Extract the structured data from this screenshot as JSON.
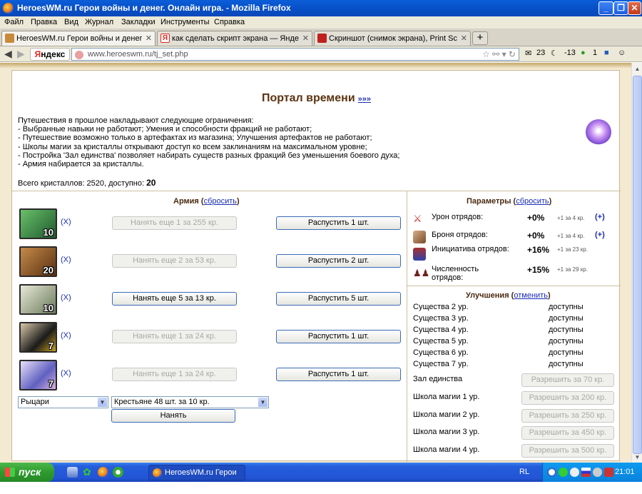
{
  "window": {
    "title": "HeroesWM.ru Герои войны и денег. Онлайн игра. - Mozilla Firefox"
  },
  "menu": [
    "Файл",
    "Правка",
    "Вид",
    "Журнал",
    "Закладки",
    "Инструменты",
    "Справка"
  ],
  "tabs": [
    {
      "label": "HeroesWM.ru Герои войны и денег. Он...",
      "favicon_color": "#c88a3a"
    },
    {
      "label": "как сделать скрипт экрана — Яндекс:...",
      "favicon_color": "#e52620"
    },
    {
      "label": "Скриншот (снимок экрана), Print Screen",
      "favicon_color": "#c02020"
    }
  ],
  "nav": {
    "yandex": "Яндекс",
    "url": "www.heroeswm.ru/tj_set.php",
    "mail_count": "23",
    "temp": "-13",
    "counter": "1"
  },
  "page": {
    "title": "Портал времени",
    "title_link": "»»»",
    "desc": [
      "Путешествия в прошлое накладывают следующие ограничения:",
      "- Выбранные навыки не работают; Умения и способности фракций не работают;",
      "- Путешествие возможно только в артефактах из магазина; Улучшения артефактов не работают;",
      "- Школы магии за кристаллы открывают доступ ко всем заклинаниям на максимальном уровне;",
      "- Постройка 'Зал единства' позволяет набирать существ разных фракций без уменьшения боевого духа;",
      "- Армия набирается за кристаллы."
    ],
    "crystals_label": "Всего кристаллов: 2520, доступно:",
    "crystals_available": "20"
  },
  "army": {
    "title": "Армия",
    "reset": "сбросить",
    "units": [
      {
        "count": "10",
        "remove": "(X)",
        "hire": "Нанять еще 1 за 255 кр.",
        "hire_enabled": false,
        "dismiss": "Распустить 1 шт.",
        "color": "#3a8a3a"
      },
      {
        "count": "20",
        "remove": "(X)",
        "hire": "Нанять еще 2 за 53 кр.",
        "hire_enabled": false,
        "dismiss": "Распустить 2 шт.",
        "color": "#8a5a2a"
      },
      {
        "count": "10",
        "remove": "(X)",
        "hire": "Нанять еще 5 за 13 кр.",
        "hire_enabled": true,
        "dismiss": "Распустить 5 шт.",
        "color": "#7a8a7a"
      },
      {
        "count": "7",
        "remove": "(X)",
        "hire": "Нанять еще 1 за 24 кр.",
        "hire_enabled": false,
        "dismiss": "Распустить 1 шт.",
        "color": "#2a2a2a"
      },
      {
        "count": "7",
        "remove": "(X)",
        "hire": "Нанять еще 1 за 24 кр.",
        "hire_enabled": false,
        "dismiss": "Распустить 1 шт.",
        "color": "#6a6ab8"
      }
    ],
    "faction_select": "Рыцари",
    "creature_select": "Крестьяне 48 шт. за 10 кр.",
    "hire_button": "Нанять"
  },
  "params": {
    "title": "Параметры",
    "reset": "сбросить",
    "rows": [
      {
        "label": "Урон отрядов:",
        "value": "+0%",
        "note": "+1 за 4 кр.",
        "plus": "(+)",
        "icon": "sword-icon"
      },
      {
        "label": "Броня отрядов:",
        "value": "+0%",
        "note": "+1 за 4 кр.",
        "plus": "(+)",
        "icon": "armor-icon"
      },
      {
        "label": "Инициатива отрядов:",
        "value": "+16%",
        "note": "+1 за 23 кр.",
        "plus": "",
        "icon": "initiative-icon"
      },
      {
        "label": "Численность отрядов:",
        "value": "+15%",
        "note": "+1 за 29 кр.",
        "plus": "",
        "icon": "troops-icon"
      }
    ]
  },
  "upgrades": {
    "title": "Улучшения",
    "cancel": "отменить",
    "creatures": [
      {
        "label": "Существа 2 ур.",
        "status": "доступны"
      },
      {
        "label": "Существа 3 ур.",
        "status": "доступны"
      },
      {
        "label": "Существа 4 ур.",
        "status": "доступны"
      },
      {
        "label": "Существа 5 ур.",
        "status": "доступны"
      },
      {
        "label": "Существа 6 ур.",
        "status": "доступны"
      },
      {
        "label": "Существа 7 ур.",
        "status": "доступны"
      }
    ],
    "buildings": [
      {
        "label": "Зал единства",
        "button": "Разрешить за 70 кр."
      },
      {
        "label": "Школа магии 1 ур.",
        "button": "Разрешить за 200 кр."
      },
      {
        "label": "Школа магии 2 ур.",
        "button": "Разрешить за 250 кр."
      },
      {
        "label": "Школа магии 3 ур.",
        "button": "Разрешить за 450 кр."
      },
      {
        "label": "Школа магии 4 ур.",
        "button": "Разрешить за 500 кр."
      }
    ]
  },
  "taskbar": {
    "start": "пуск",
    "task": "HeroesWM.ru Герои ...",
    "lang": "RL",
    "clock": "21:01"
  }
}
